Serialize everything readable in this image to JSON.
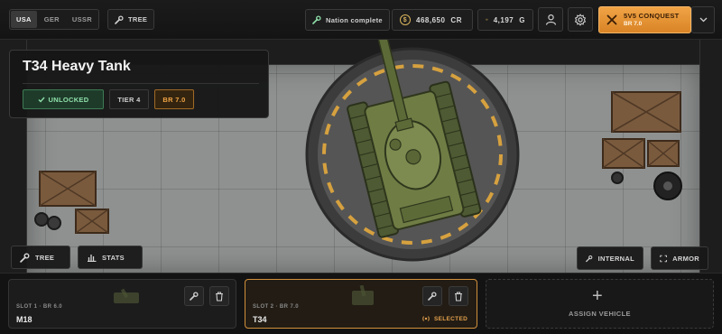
{
  "top_bar": {
    "nations": [
      {
        "label": "USA",
        "active": true
      },
      {
        "label": "GER",
        "active": false
      },
      {
        "label": "USSR",
        "active": false
      }
    ],
    "tree_label": "TREE",
    "nation_complete_label": "Nation complete",
    "currency": {
      "credits": "468,650",
      "credits_unit": "CR",
      "gold": "4,197",
      "gold_unit": "G"
    },
    "game_mode": {
      "title": "5V5 CONQUEST",
      "subtitle": "BR 7.0"
    }
  },
  "vehicle": {
    "name": "T34 Heavy Tank",
    "status": "UNLOCKED",
    "tier": "TIER 4",
    "br": "BR 7.0"
  },
  "hangar_buttons": {
    "tree": "TREE",
    "stats": "STATS",
    "internal": "INTERNAL",
    "armor": "ARMOR"
  },
  "slots": [
    {
      "label": "SLOT 1 · BR 6.0",
      "name": "M18",
      "selected": false
    },
    {
      "label": "SLOT 2 · BR 7.0",
      "name": "T34",
      "selected": true,
      "selected_label": "SELECTED"
    }
  ],
  "assign_slot": {
    "plus": "+",
    "label": "ASSIGN VEHICLE"
  },
  "colors": {
    "accent": "#f0a345",
    "unlocked": "#8fe0aa",
    "tank": "#6f7d45"
  }
}
